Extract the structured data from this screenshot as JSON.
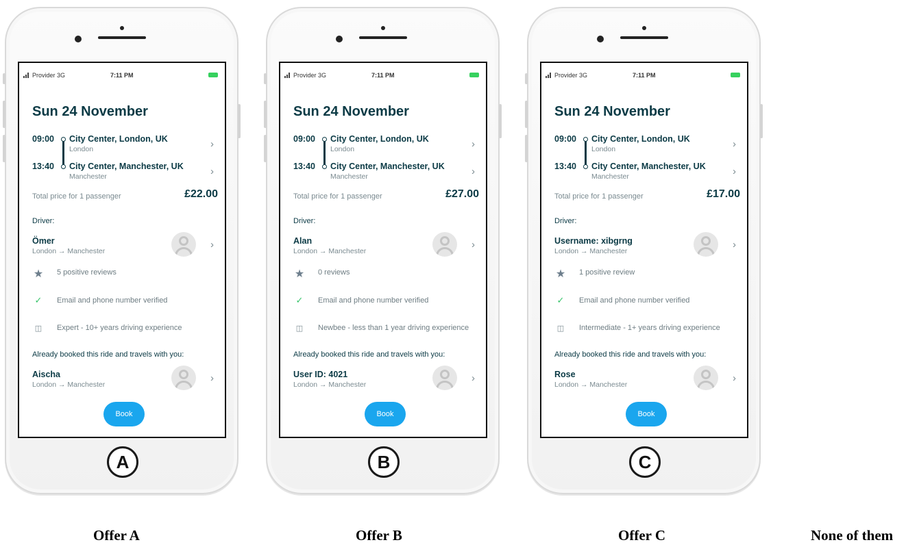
{
  "status_bar": {
    "provider": "Provider 3G",
    "time": "7:11 PM",
    "battery_color": "#36d15e"
  },
  "common": {
    "date": "Sun 24 November",
    "departure_time": "09:00",
    "departure_city": "City Center, London, UK",
    "departure_sub": "London",
    "arrival_time": "13:40",
    "arrival_city": "City Center, Manchester, UK",
    "arrival_sub": "Manchester",
    "price_label": "Total price for 1 passenger",
    "driver_label": "Driver:",
    "trip": "London → Manchester",
    "verified": "Email and phone number verified",
    "co_passenger_label": "Already booked this ride and travels with you:",
    "book_label": "Book",
    "accent_color": "#1aa6ee",
    "primary_color": "#0b3a45"
  },
  "offers": [
    {
      "home_letter": "A",
      "price": "£22.00",
      "driver": "Ömer",
      "reviews": "5 positive reviews",
      "experience": "Expert - 10+ years driving experience",
      "co_passenger": "Aischa",
      "label": "Offer A"
    },
    {
      "home_letter": "B",
      "price": "£27.00",
      "driver": "Alan",
      "reviews": "0 reviews",
      "experience": "Newbee - less than 1 year driving experience",
      "co_passenger": "User ID: 4021",
      "label": "Offer B"
    },
    {
      "home_letter": "C",
      "price": "£17.00",
      "driver": "Username: xibgrng",
      "reviews": "1 positive review",
      "experience": "Intermediate - 1+ years driving experience",
      "co_passenger": "Rose",
      "label": "Offer C"
    }
  ],
  "none_label": "None of them",
  "icons": {
    "chevron": "chevron-right-icon",
    "star": "star-icon",
    "check": "check-icon",
    "car": "car-icon",
    "avatar": "avatar-icon"
  }
}
